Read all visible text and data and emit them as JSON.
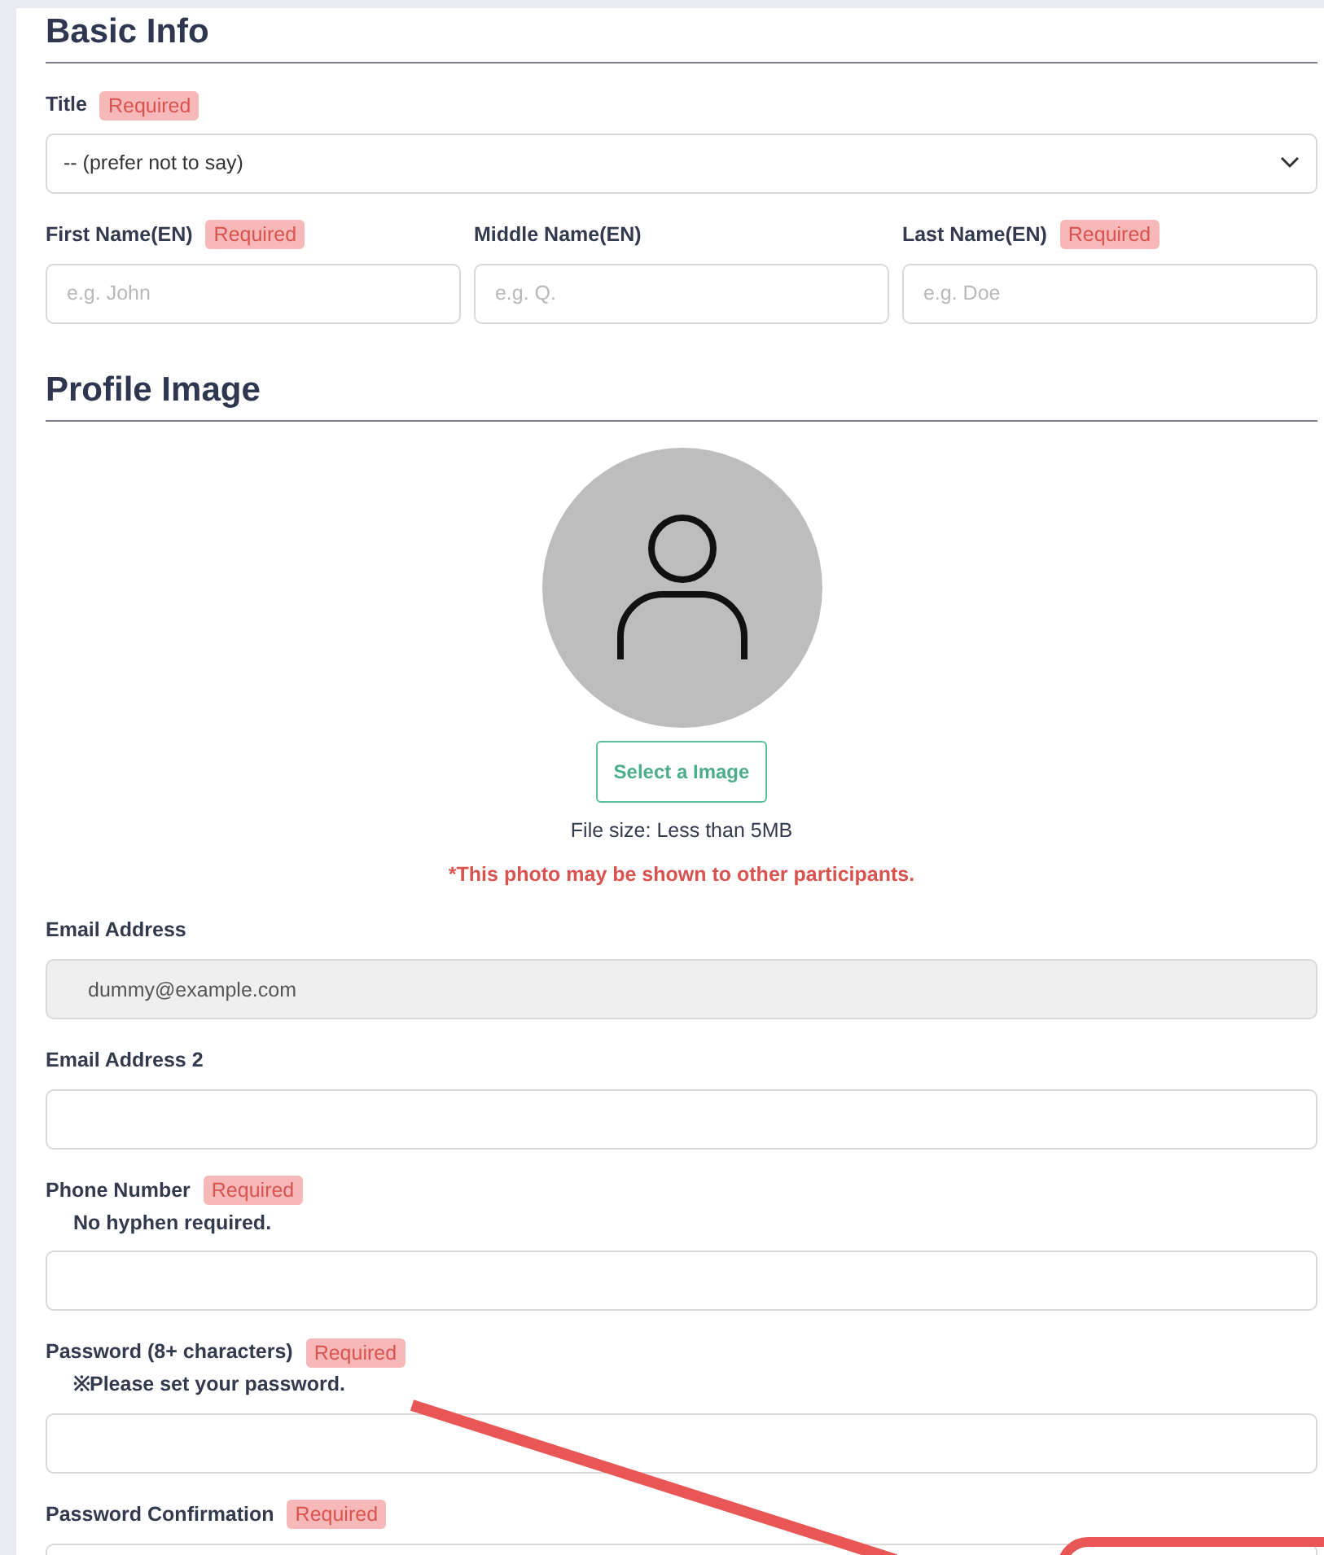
{
  "basic_info": {
    "heading": "Basic Info",
    "title_field": {
      "label": "Title",
      "badge": "Required",
      "value": "-- (prefer not to say)"
    },
    "name_fields": [
      {
        "label": "First Name(EN)",
        "badge": "Required",
        "placeholder": "e.g. John"
      },
      {
        "label": "Middle Name(EN)",
        "placeholder": "e.g. Q."
      },
      {
        "label": "Last Name(EN)",
        "badge": "Required",
        "placeholder": "e.g. Doe"
      }
    ]
  },
  "profile_image": {
    "heading": "Profile Image",
    "button": "Select a Image",
    "file_size": "File size: Less than 5MB",
    "warning": "*This photo may be shown to other participants."
  },
  "fields": [
    {
      "label": "Email Address",
      "value": "dummy@example.com",
      "disabled": true
    },
    {
      "label": "Email Address 2",
      "disabled": false
    },
    {
      "label": "Phone Number",
      "badge": "Required",
      "note": "No hyphen required.",
      "disabled": false
    },
    {
      "label": "Password (8+ characters)",
      "badge": "Required",
      "note": "※Please set your password.",
      "disabled": false
    },
    {
      "label": "Password Confirmation",
      "badge": "Required",
      "disabled": false
    }
  ]
}
